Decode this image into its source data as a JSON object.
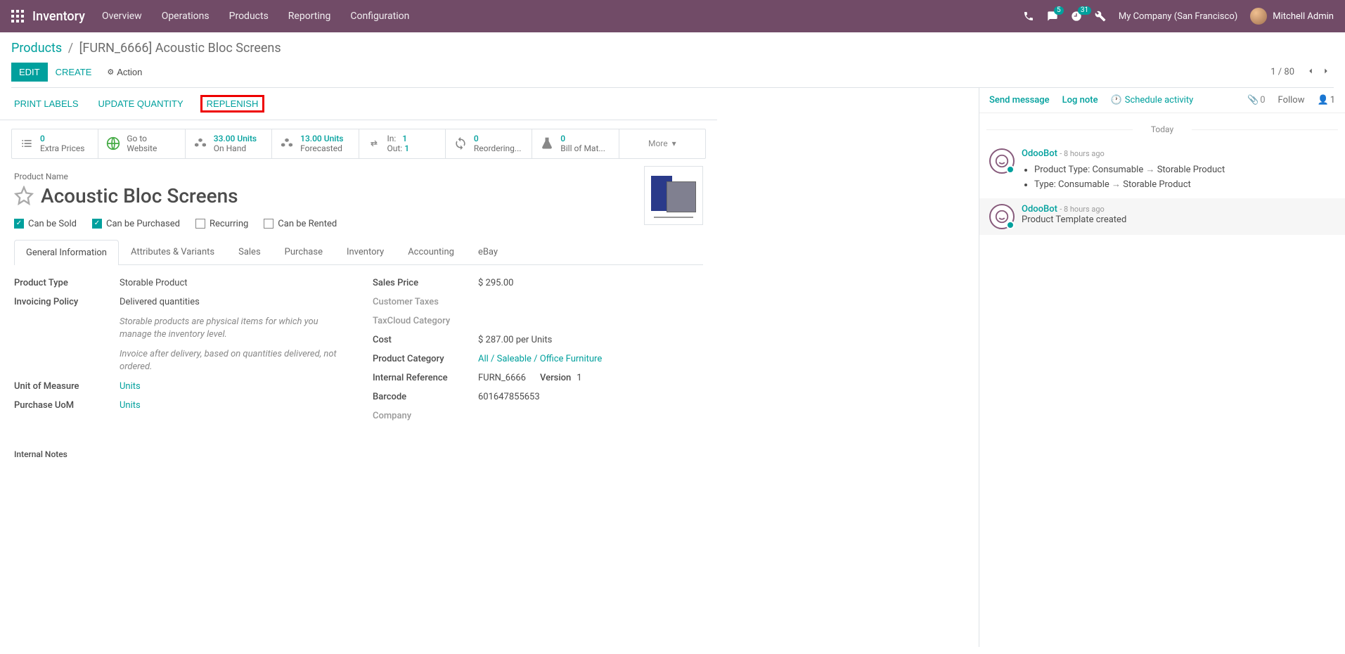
{
  "topnav": {
    "brand": "Inventory",
    "menu": [
      "Overview",
      "Operations",
      "Products",
      "Reporting",
      "Configuration"
    ],
    "chat_badge": "5",
    "clock_badge": "31",
    "company": "My Company (San Francisco)",
    "user": "Mitchell Admin"
  },
  "breadcrumb": {
    "parent": "Products",
    "current": "[FURN_6666] Acoustic Bloc Screens"
  },
  "controls": {
    "edit": "EDIT",
    "create": "CREATE",
    "action": "Action",
    "pager": "1 / 80"
  },
  "action_buttons": {
    "print_labels": "PRINT LABELS",
    "update_qty": "UPDATE QUANTITY",
    "replenish": "REPLENISH"
  },
  "stats": {
    "extra_prices": {
      "num": "0",
      "label": "Extra Prices"
    },
    "website": {
      "line1": "Go to",
      "line2": "Website"
    },
    "onhand": {
      "num": "33.00 Units",
      "label": "On Hand"
    },
    "forecasted": {
      "num": "13.00 Units",
      "label": "Forecasted"
    },
    "transfers": {
      "in_label": "In:",
      "in_val": "1",
      "out_label": "Out:",
      "out_val": "1"
    },
    "reordering": {
      "num": "0",
      "label": "Reordering..."
    },
    "bom": {
      "num": "0",
      "label": "Bill of Mat..."
    },
    "more": "More"
  },
  "product": {
    "name_label": "Product Name",
    "name": "Acoustic Bloc Screens",
    "can_be_sold": "Can be Sold",
    "can_be_purchased": "Can be Purchased",
    "recurring": "Recurring",
    "can_be_rented": "Can be Rented"
  },
  "tabs": [
    "General Information",
    "Attributes & Variants",
    "Sales",
    "Purchase",
    "Inventory",
    "Accounting",
    "eBay"
  ],
  "fields": {
    "product_type": {
      "label": "Product Type",
      "value": "Storable Product"
    },
    "invoicing_policy": {
      "label": "Invoicing Policy",
      "value": "Delivered quantities"
    },
    "help1": "Storable products are physical items for which you manage the inventory level.",
    "help2": "Invoice after delivery, based on quantities delivered, not ordered.",
    "uom": {
      "label": "Unit of Measure",
      "value": "Units"
    },
    "purchase_uom": {
      "label": "Purchase UoM",
      "value": "Units"
    },
    "sales_price": {
      "label": "Sales Price",
      "value": "$ 295.00"
    },
    "customer_taxes": {
      "label": "Customer Taxes"
    },
    "taxcloud": {
      "label": "TaxCloud Category"
    },
    "cost": {
      "label": "Cost",
      "value": "$ 287.00",
      "per": "per Units"
    },
    "category": {
      "label": "Product Category",
      "value": "All / Saleable / Office Furniture"
    },
    "internal_ref": {
      "label": "Internal Reference",
      "value": "FURN_6666"
    },
    "version": {
      "label": "Version",
      "value": "1"
    },
    "barcode": {
      "label": "Barcode",
      "value": "601647855653"
    },
    "company": {
      "label": "Company"
    },
    "notes": "Internal Notes"
  },
  "chatter": {
    "send_message": "Send message",
    "log_note": "Log note",
    "schedule": "Schedule activity",
    "attach_count": "0",
    "follow": "Follow",
    "follower_count": "1",
    "today": "Today",
    "messages": [
      {
        "author": "OdooBot",
        "time": "- 8 hours ago",
        "changes": [
          {
            "field": "Product Type:",
            "from": "Consumable",
            "to": "Storable Product"
          },
          {
            "field": "Type:",
            "from": "Consumable",
            "to": "Storable Product"
          }
        ]
      },
      {
        "author": "OdooBot",
        "time": "- 8 hours ago",
        "text": "Product Template created"
      }
    ]
  }
}
